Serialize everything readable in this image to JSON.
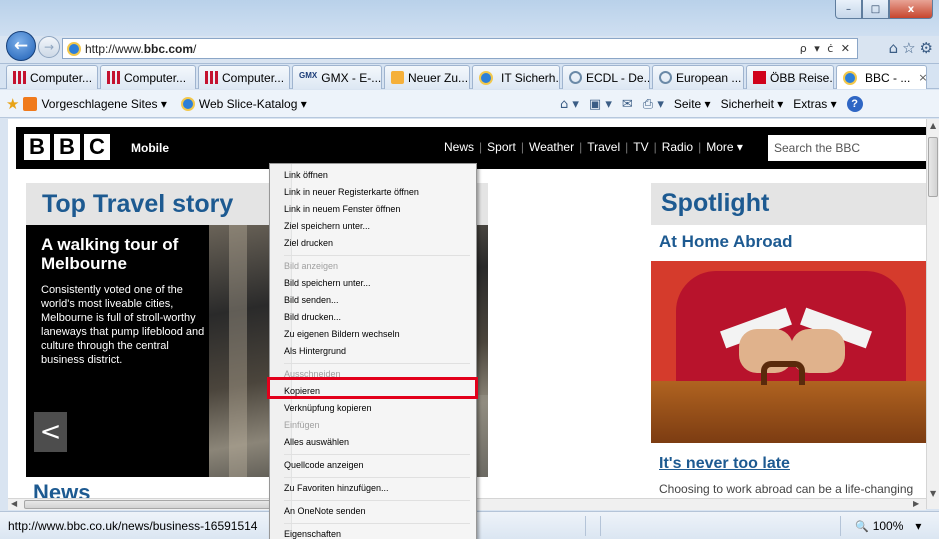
{
  "browser": {
    "url_prefix": "http://www.",
    "url_domain": "bbc.com",
    "url_suffix": "/",
    "address_tools": "ρ ▾ ċ ✕",
    "window_controls": [
      "–",
      "□",
      "x"
    ]
  },
  "tabs": [
    {
      "label": "Computer...",
      "icon": "bbc-bars"
    },
    {
      "label": "Computer...",
      "icon": "bbc-bars"
    },
    {
      "label": "Computer...",
      "icon": "bbc-bars"
    },
    {
      "label": "GMX - E-...",
      "icon": "gmx"
    },
    {
      "label": "Neuer Zu...",
      "icon": "leaf"
    },
    {
      "label": "IT Sicherh...",
      "icon": "ie"
    },
    {
      "label": "ECDL - De...",
      "icon": "circle"
    },
    {
      "label": "European ...",
      "icon": "circle"
    },
    {
      "label": "ÖBB Reise...",
      "icon": "obb"
    },
    {
      "label": "BBC - ...",
      "icon": "ie",
      "active": true,
      "close": "×"
    }
  ],
  "favorites": {
    "suggested_sites": "Vorgeschlagene Sites ▾",
    "web_slice": "Web Slice-Katalog ▾",
    "gmx_logo": "GMX",
    "page_menu": "Seite ▾",
    "safety_menu": "Sicherheit ▾",
    "extras_menu": "Extras ▾",
    "help": "?"
  },
  "bbc": {
    "logo": [
      "B",
      "B",
      "C"
    ],
    "mobile": "Mobile",
    "nav": [
      "News",
      "Sport",
      "Weather",
      "Travel",
      "TV",
      "Radio",
      "More ▾"
    ],
    "search_placeholder": "Search the BBC"
  },
  "top_story": {
    "heading": "Top Travel story",
    "headline": "A walking tour of Melbourne",
    "body": "Consistently voted one of the world's most liveable cities, Melbourne is full of stroll-worthy laneways that pump lifeblood and culture through the central business district.",
    "prev": "<",
    "next": ">",
    "pager_active_index": 2,
    "pager_count": 8
  },
  "news_partial": "News",
  "spotlight": {
    "heading": "Spotlight",
    "subheading": "At Home Abroad",
    "link": "It's never too late",
    "text": "Choosing to work abroad can be a life-changing"
  },
  "context_menu": {
    "items": [
      {
        "label": "Link öffnen",
        "enabled": true
      },
      {
        "label": "Link in neuer Registerkarte öffnen",
        "enabled": true
      },
      {
        "label": "Link in neuem Fenster öffnen",
        "enabled": true
      },
      {
        "label": "Ziel speichern unter...",
        "enabled": true
      },
      {
        "label": "Ziel drucken",
        "enabled": true
      },
      {
        "label": "Bild anzeigen",
        "enabled": false
      },
      {
        "label": "Bild speichern unter...",
        "enabled": true
      },
      {
        "label": "Bild senden...",
        "enabled": true
      },
      {
        "label": "Bild drucken...",
        "enabled": true
      },
      {
        "label": "Zu eigenen Bildern wechseln",
        "enabled": true
      },
      {
        "label": "Als Hintergrund",
        "enabled": true
      },
      {
        "label": "Ausschneiden",
        "enabled": false
      },
      {
        "label": "Kopieren",
        "enabled": true,
        "highlighted": true
      },
      {
        "label": "Verknüpfung kopieren",
        "enabled": true
      },
      {
        "label": "Einfügen",
        "enabled": false
      },
      {
        "label": "Alles auswählen",
        "enabled": true
      },
      {
        "label": "Quellcode anzeigen",
        "enabled": true
      },
      {
        "label": "Zu Favoriten hinzufügen...",
        "enabled": true
      },
      {
        "label": "An OneNote senden",
        "enabled": true
      },
      {
        "label": "Eigenschaften",
        "enabled": true
      }
    ],
    "highlight_color": "#e3001b"
  },
  "status_bar": {
    "url": "http://www.bbc.co.uk/news/business-16591514",
    "zoom": "100%",
    "zoom_dropdown": "▾"
  }
}
